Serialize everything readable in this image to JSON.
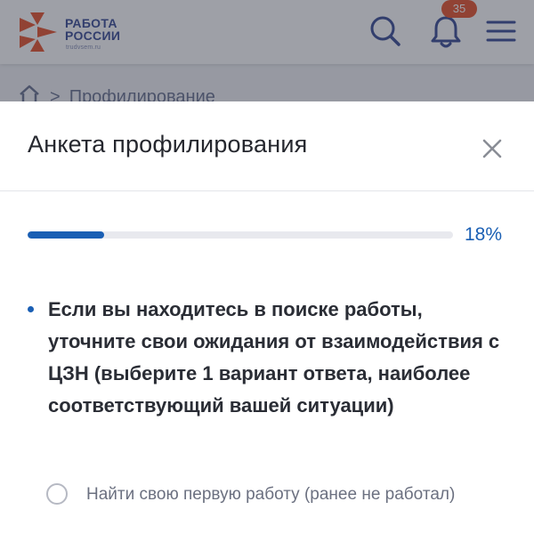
{
  "header": {
    "logo": {
      "line1": "РАБОТА",
      "line2": "РОССИИ",
      "domain": "trudvsem.ru",
      "colors": [
        "#e8542e",
        "#3b4e96"
      ]
    },
    "icons": [
      "search-icon",
      "bell-icon",
      "menu-icon"
    ],
    "notifications_count": "35"
  },
  "breadcrumb": {
    "home_icon": "home-icon",
    "separator": ">",
    "current": "Профилирование"
  },
  "modal": {
    "title": "Анкета профилирования",
    "close_icon": "close-icon",
    "progress": {
      "value": 0.18,
      "label": "18%"
    },
    "question": "Если вы находитесь в поиске работы, уточните свои ожидания от взаимодействия с ЦЗН (выберите 1 вариант ответа, наиболее соответствующий вашей ситуации)",
    "options": [
      {
        "label": "Найти свою первую работу (ранее не работал)",
        "selected": false
      }
    ]
  },
  "colors": {
    "accent": "#1a5fb4",
    "badge": "#e8542e",
    "brand": "#3b4e96"
  }
}
